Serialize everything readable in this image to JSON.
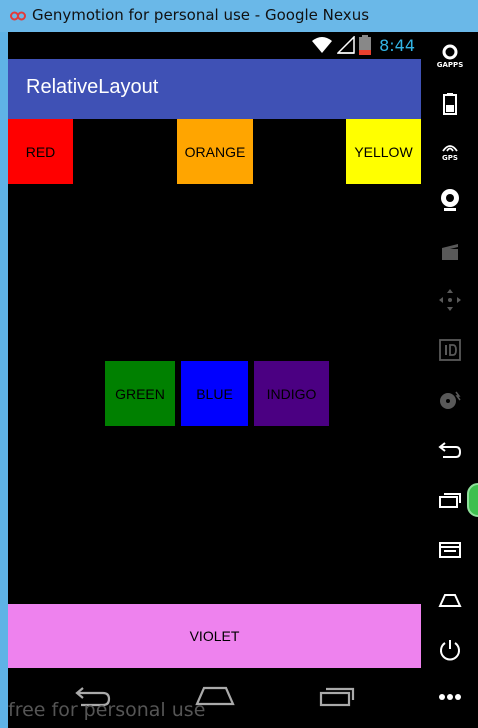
{
  "window": {
    "title": "Genymotion for personal use - Google Nexus"
  },
  "statusbar": {
    "time": "8:44",
    "icons": [
      "wifi-icon",
      "signal-icon",
      "battery-icon"
    ]
  },
  "app": {
    "title": "RelativeLayout"
  },
  "boxes": {
    "red": "RED",
    "orange": "ORANGE",
    "yellow": "YELLOW",
    "green": "GREEN",
    "blue": "BLUE",
    "indigo": "INDIGO",
    "violet": "VIOLET"
  },
  "colors": {
    "red": "#ff0000",
    "orange": "#ffa500",
    "yellow": "#ffff00",
    "green": "#008000",
    "blue": "#0000ff",
    "indigo": "#4b0082",
    "violet": "#ee82ee",
    "actionbar": "#3f51b5",
    "clock": "#33b5e5"
  },
  "navbar": {
    "watermark": "free for personal use",
    "buttons": [
      "back-icon",
      "home-icon",
      "recents-icon"
    ]
  },
  "side_toolbar": {
    "gapps_label": "GAPPS",
    "gps_label": "GPS",
    "tools": [
      "gapps-icon",
      "battery-icon",
      "gps-icon",
      "camera-icon",
      "clapper-icon",
      "dpad-icon",
      "id-icon",
      "disk-icon",
      "back-icon",
      "recents-icon",
      "menu-icon",
      "home-icon",
      "power-icon",
      "more-icon"
    ]
  }
}
